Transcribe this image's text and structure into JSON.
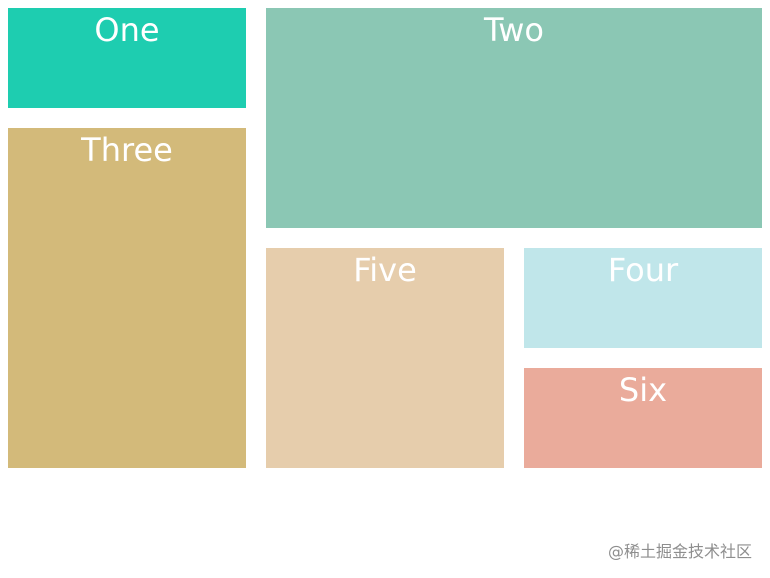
{
  "boxes": {
    "one": {
      "label": "One",
      "color": "#1ecdb0"
    },
    "two": {
      "label": "Two",
      "color": "#8bc7b4"
    },
    "three": {
      "label": "Three",
      "color": "#d3ba7a"
    },
    "five": {
      "label": "Five",
      "color": "#e6cdac"
    },
    "four": {
      "label": "Four",
      "color": "#c0e6ea"
    },
    "six": {
      "label": "Six",
      "color": "#eaab9b"
    }
  },
  "watermark": "@稀土掘金技术社区"
}
